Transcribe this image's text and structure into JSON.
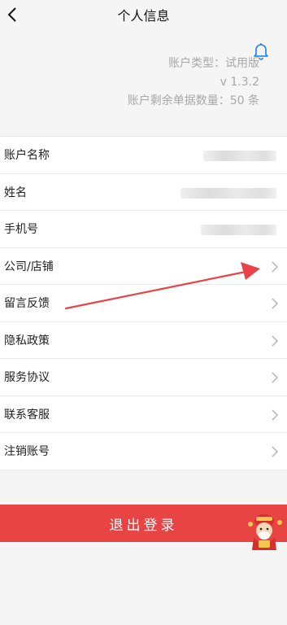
{
  "header": {
    "title": "个人信息",
    "back_icon": "chevron-left-icon"
  },
  "notification_icon": "bell-icon",
  "account": {
    "type": "账户类型：试用版",
    "version": "v 1.3.2",
    "remaining": "账户剩余单据数量：50 条"
  },
  "menu": [
    {
      "label": "账户名称",
      "value_redacted": true
    },
    {
      "label": "姓名",
      "value_redacted": true
    },
    {
      "label": "手机号",
      "value_redacted": true
    },
    {
      "label": "公司/店铺"
    },
    {
      "label": "留言反馈"
    },
    {
      "label": "隐私政策"
    },
    {
      "label": "服务协议"
    },
    {
      "label": "联系客服"
    },
    {
      "label": "注销账号"
    }
  ],
  "logout_label": "退出登录",
  "colors": {
    "accent_red": "#e94444",
    "bell_blue": "#2f8ef0",
    "annotation_red": "#e8434a"
  }
}
